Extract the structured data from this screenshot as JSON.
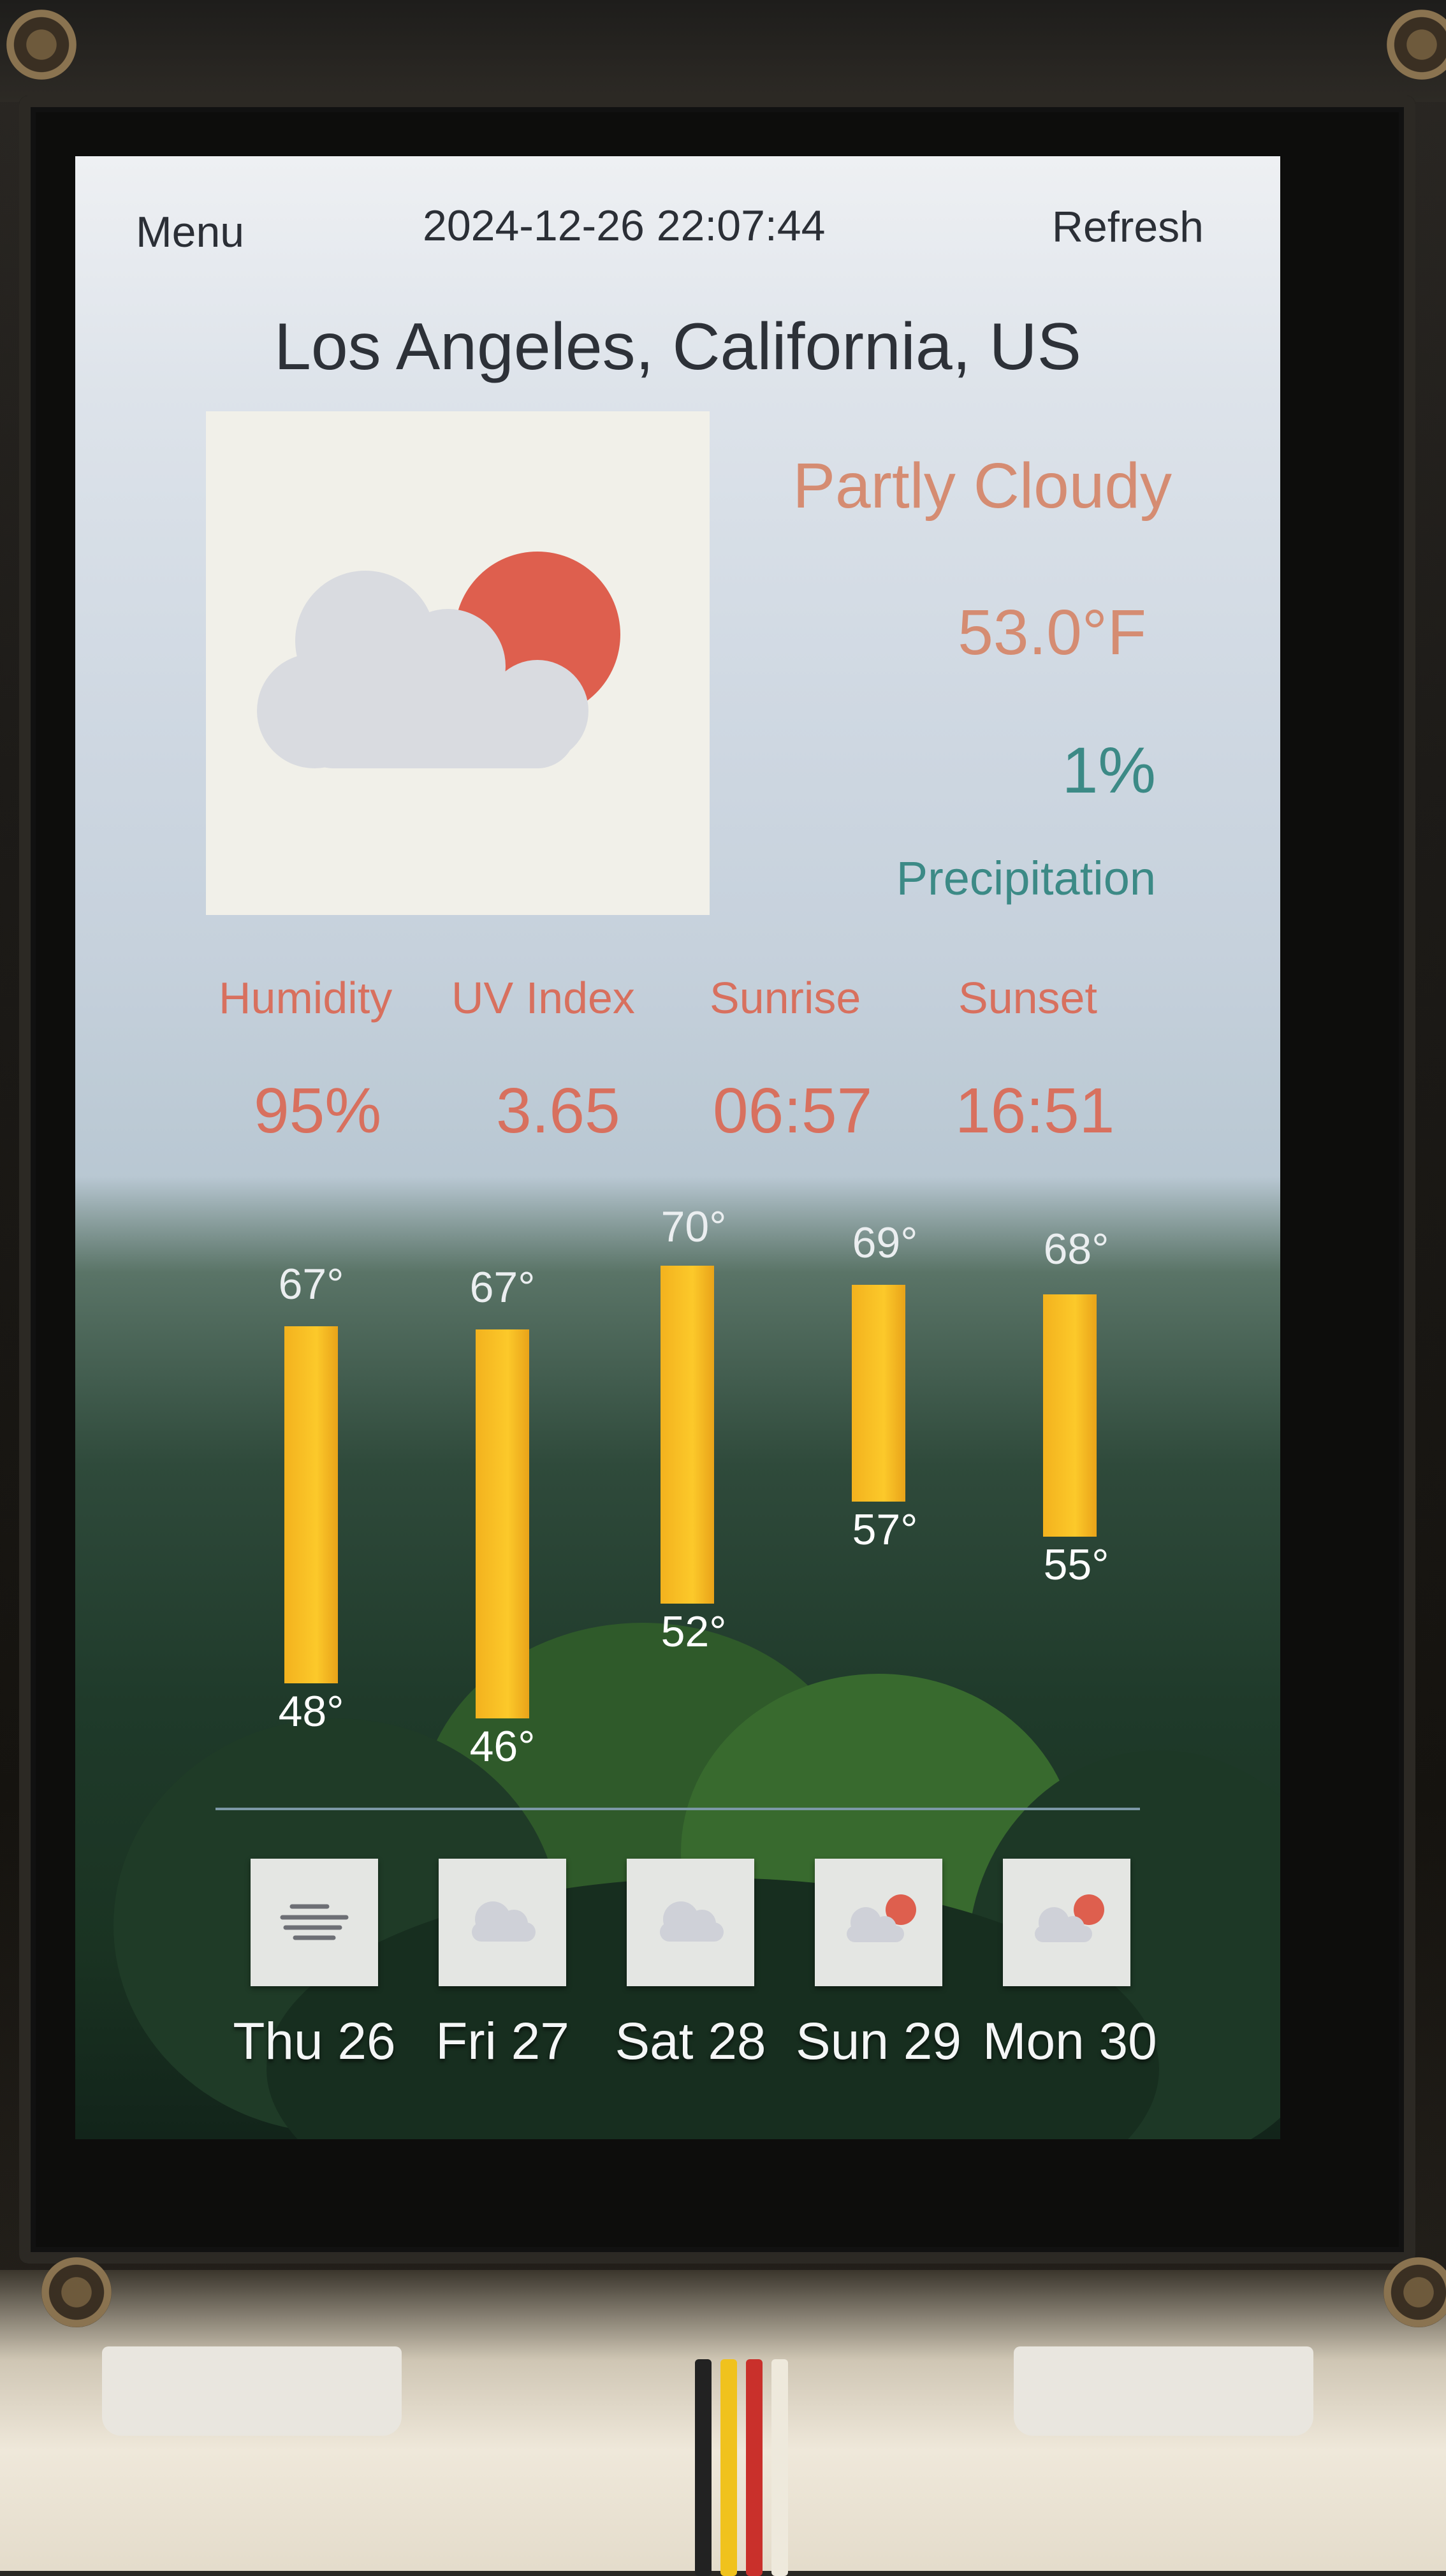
{
  "topbar": {
    "menu_label": "Menu",
    "datetime": "2024-12-26 22:07:44",
    "refresh_label": "Refresh"
  },
  "location": "Los Angeles, California, US",
  "current": {
    "icon": "partly-cloudy-icon",
    "condition": "Partly Cloudy",
    "temperature": "53.0°F",
    "precipitation_value": "1%",
    "precipitation_label": "Precipitation"
  },
  "stats": [
    {
      "label": "Humidity",
      "value": "95%"
    },
    {
      "label": "UV Index",
      "value": "3.65"
    },
    {
      "label": "Sunrise",
      "value": "06:57"
    },
    {
      "label": "Sunset",
      "value": "16:51"
    }
  ],
  "forecast": [
    {
      "day": "Thu 26",
      "high": "67°",
      "low": "48°",
      "icon": "fog-icon"
    },
    {
      "day": "Fri 27",
      "high": "67°",
      "low": "46°",
      "icon": "cloud-icon"
    },
    {
      "day": "Sat 28",
      "high": "70°",
      "low": "52°",
      "icon": "cloud-icon"
    },
    {
      "day": "Sun 29",
      "high": "69°",
      "low": "57°",
      "icon": "partly-cloudy-icon"
    },
    {
      "day": "Mon 30",
      "high": "68°",
      "low": "55°",
      "icon": "partly-cloudy-icon"
    }
  ],
  "colors": {
    "accent_text": "#d8705e",
    "precip_text": "#3c8a86",
    "bar": "#fcc92a",
    "sun": "#de5f4e"
  }
}
